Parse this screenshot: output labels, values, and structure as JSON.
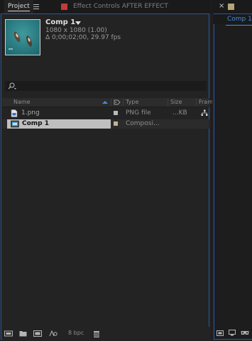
{
  "project_panel": {
    "tab_label": "Project",
    "effects_tab_label": "Effect Controls AFTER EFFECT",
    "comp_info": {
      "name": "Comp 1",
      "dimensions": "1080 x 1080 (1.00)",
      "duration": "Δ 0;00;02;00, 29.97 fps"
    },
    "columns": {
      "name": "Name",
      "type": "Type",
      "size": "Size",
      "frame": "Fram"
    },
    "items": [
      {
        "name": "1.png",
        "type": "PNG file",
        "size": "...KB",
        "label_color": "#b9b9b9",
        "selected": false,
        "icon": "image-file-icon"
      },
      {
        "name": "Comp 1",
        "type": "Composi...",
        "size": "",
        "label_color": "#c8b290",
        "selected": true,
        "icon": "composition-icon"
      }
    ],
    "footer": {
      "bpc_label": "8 bpc"
    }
  },
  "right_panel": {
    "comp_tab_label": "Comp 1"
  },
  "colors": {
    "accent_blue": "#3f8de0",
    "panel_border": "#2a55a8",
    "lock_red": "#c23a3a"
  }
}
